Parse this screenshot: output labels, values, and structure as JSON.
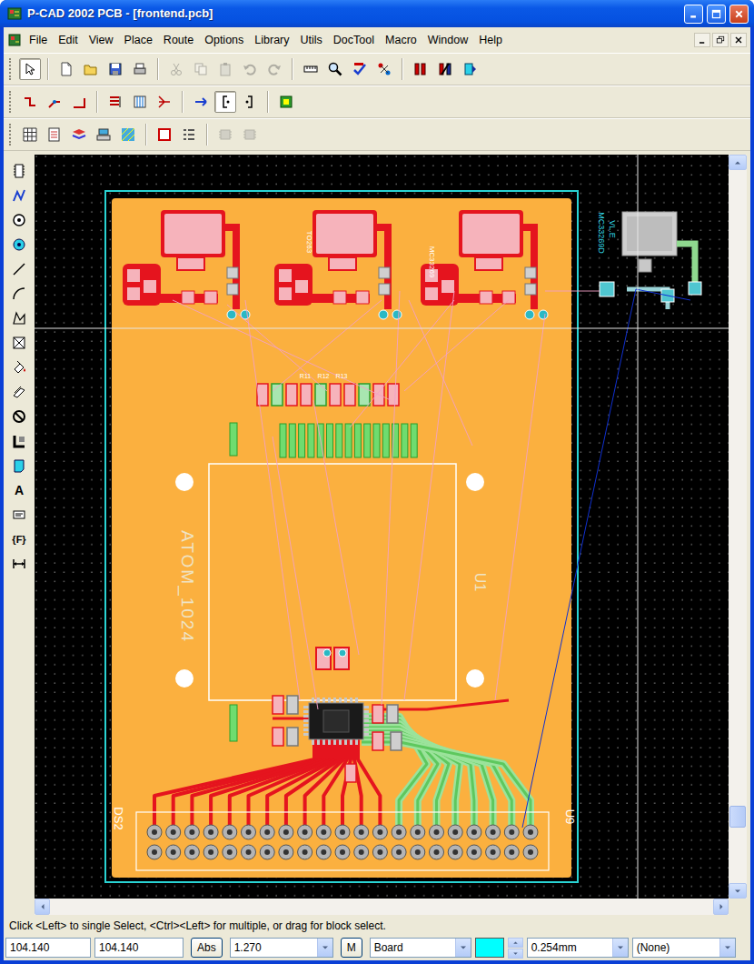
{
  "window": {
    "title": "P-CAD 2002 PCB - [frontend.pcb]"
  },
  "menu": [
    "File",
    "Edit",
    "View",
    "Place",
    "Route",
    "Options",
    "Library",
    "Utils",
    "DocTool",
    "Macro",
    "Window",
    "Help"
  ],
  "toolbars": [
    [
      {
        "selected": true,
        "disabled": false
      },
      {
        "selected": false,
        "disabled": false
      },
      {
        "selected": false,
        "disabled": false
      },
      {
        "selected": false,
        "disabled": false
      },
      {
        "selected": false,
        "disabled": false
      },
      {
        "selected": false,
        "disabled": true
      },
      {
        "selected": false,
        "disabled": true
      },
      {
        "selected": false,
        "disabled": true
      },
      {
        "selected": false,
        "disabled": true
      },
      {
        "selected": false,
        "disabled": true
      },
      {
        "selected": false,
        "disabled": false
      },
      {
        "selected": false,
        "disabled": false
      },
      {
        "selected": false,
        "disabled": false
      },
      {
        "selected": false,
        "disabled": false
      },
      {
        "selected": false,
        "disabled": false
      },
      {
        "selected": false,
        "disabled": false
      },
      {
        "selected": false,
        "disabled": false
      }
    ],
    [
      {
        "selected": false,
        "disabled": false
      },
      {
        "selected": false,
        "disabled": false
      },
      {
        "selected": false,
        "disabled": false
      },
      {
        "selected": false,
        "disabled": false
      },
      {
        "selected": false,
        "disabled": false
      },
      {
        "selected": false,
        "disabled": false
      },
      {
        "selected": false,
        "disabled": false
      },
      {
        "selected": true,
        "disabled": false
      },
      {
        "selected": false,
        "disabled": false
      },
      {
        "selected": false,
        "disabled": false
      }
    ],
    [
      {
        "selected": false,
        "disabled": false
      },
      {
        "selected": false,
        "disabled": false
      },
      {
        "selected": false,
        "disabled": false
      },
      {
        "selected": false,
        "disabled": false
      },
      {
        "selected": false,
        "disabled": false
      },
      {
        "selected": false,
        "disabled": false
      },
      {
        "selected": false,
        "disabled": false
      },
      {
        "selected": false,
        "disabled": true
      },
      {
        "selected": false,
        "disabled": true
      }
    ]
  ],
  "tools": [
    {
      "selected": false
    },
    {
      "selected": false
    },
    {
      "selected": false
    },
    {
      "selected": false
    },
    {
      "selected": false
    },
    {
      "selected": false
    },
    {
      "selected": false
    },
    {
      "selected": false
    },
    {
      "selected": false
    },
    {
      "selected": false
    },
    {
      "selected": false
    },
    {
      "selected": false
    },
    {
      "selected": false
    },
    {
      "selected": false,
      "glyph": "A"
    },
    {
      "selected": false
    },
    {
      "selected": false,
      "glyph": "{F}"
    },
    {
      "selected": false
    }
  ],
  "board": {
    "labels": [
      "ATOM_1024",
      "U1",
      "DS2",
      "U9",
      "MC33269D",
      "VL.E",
      "MC33269",
      "TO263",
      "R11",
      "R12",
      "R13"
    ]
  },
  "scrollbars": {
    "vertical": {
      "level": 0.92
    }
  },
  "status_bar": {
    "hint": "Click <Left> to single Select, <Ctrl><Left> for multiple, or drag for block select.",
    "x": "104.140",
    "y": "104.140",
    "mode": "Abs",
    "grid": "1.270",
    "m": "M",
    "layer": "Board",
    "layer_color": "#00ffff",
    "width": "0.254mm",
    "net": "(None)"
  }
}
